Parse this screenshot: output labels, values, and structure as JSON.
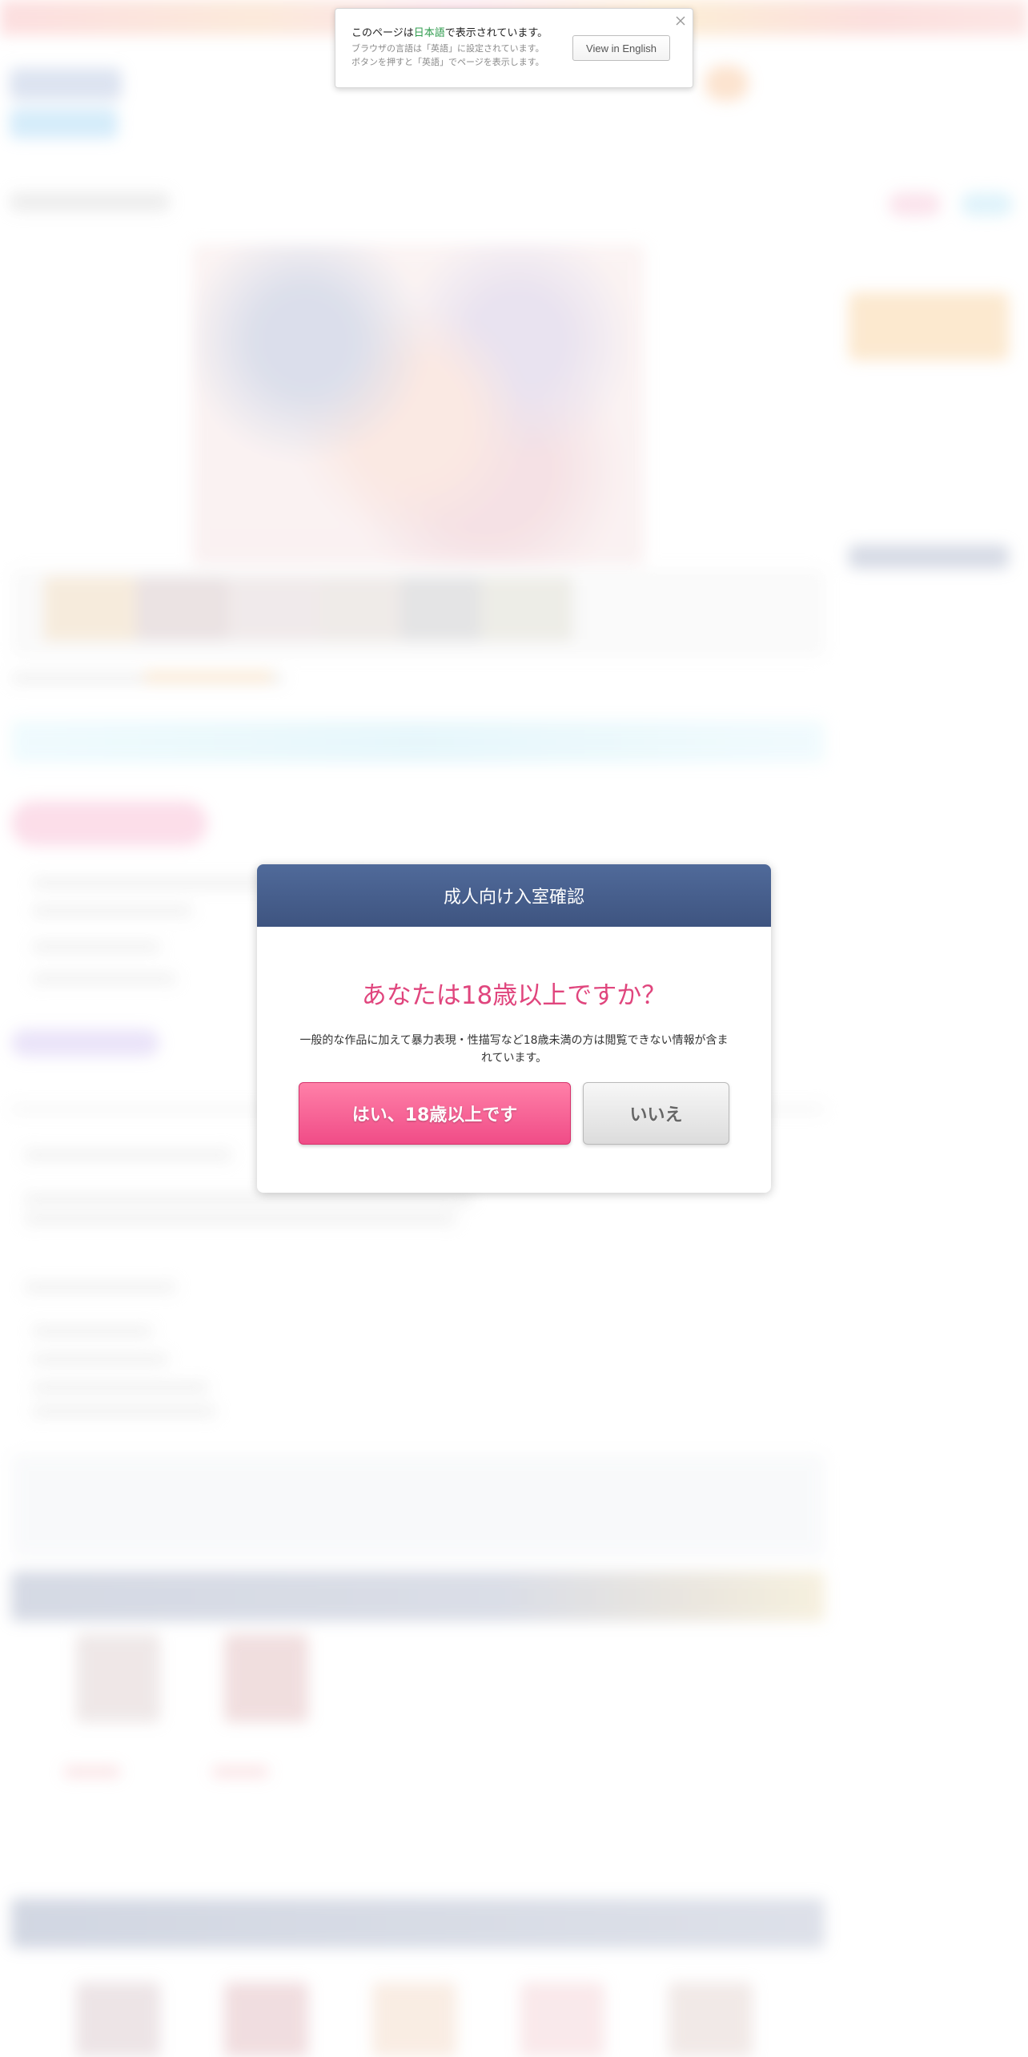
{
  "language_bar": {
    "message_prefix": "このページは",
    "message_language": "日本語",
    "message_suffix": "で表示されています。",
    "sub_line1": "ブラウザの言語は「英語」に設定されています。",
    "sub_line2": "ボタンを押すと「英語」でページを表示します。",
    "button_label": "View in English",
    "close_icon": "close-icon",
    "highlight_color": "#2e9b4d"
  },
  "age_modal": {
    "title": "成人向け入室確認",
    "question": "あなたは18歳以上ですか？",
    "description": "一般的な作品に加えて暴力表現・性描写など18歳未満の方は閲覧できない情報が含まれています。",
    "yes_label": "はい、18歳以上です",
    "no_label": "いいえ",
    "header_color": "#44598a",
    "question_color": "#e0457d",
    "yes_color": "#f04c87"
  }
}
